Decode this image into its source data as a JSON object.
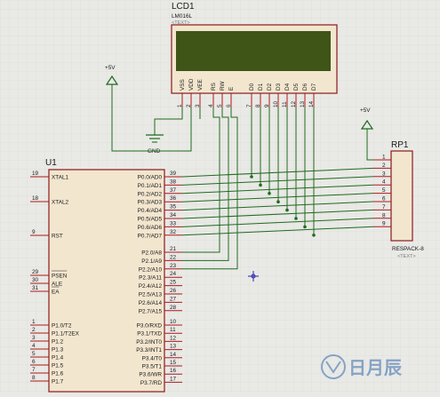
{
  "colors": {
    "background": "#e9e9e6",
    "grid": "#d7d7d2",
    "wire": "#1f6b1f",
    "body_fill": "#f2e6cf",
    "body_stroke": "#8b1a1a",
    "lcd_screen": "#3f5417",
    "pin_red": "#b01818",
    "probe": "#2b2bb0"
  },
  "lcd": {
    "designator": "LCD1",
    "part": "LM016L",
    "text_tag": "<TEXT>",
    "pin_names": [
      "VSS",
      "VDD",
      "VEE",
      "RS",
      "RW",
      "E",
      "D0",
      "D1",
      "D2",
      "D3",
      "D4",
      "D5",
      "D6",
      "D7"
    ],
    "pin_numbers": [
      "1",
      "2",
      "3",
      "4",
      "5",
      "6",
      "7",
      "8",
      "9",
      "10",
      "11",
      "12",
      "13",
      "14"
    ]
  },
  "power": {
    "vcc_left": "+5V",
    "vcc_right": "+5V",
    "gnd": "GND"
  },
  "mcu": {
    "designator": "U1",
    "left_pins": [
      {
        "num": "19",
        "name": "XTAL1"
      },
      {
        "num": "18",
        "name": "XTAL2"
      },
      {
        "num": "9",
        "name": "RST"
      },
      {
        "num": "29",
        "name": "PSEN"
      },
      {
        "num": "30",
        "name": "ALE"
      },
      {
        "num": "31",
        "name": "EA"
      },
      {
        "num": "1",
        "name": "P1.0/T2"
      },
      {
        "num": "2",
        "name": "P1.1/T2EX"
      },
      {
        "num": "3",
        "name": "P1.2"
      },
      {
        "num": "4",
        "name": "P1.3"
      },
      {
        "num": "5",
        "name": "P1.4"
      },
      {
        "num": "6",
        "name": "P1.5"
      },
      {
        "num": "7",
        "name": "P1.6"
      },
      {
        "num": "8",
        "name": "P1.7"
      }
    ],
    "right_pins": [
      {
        "num": "39",
        "name": "P0.0/AD0"
      },
      {
        "num": "38",
        "name": "P0.1/AD1"
      },
      {
        "num": "37",
        "name": "P0.2/AD2"
      },
      {
        "num": "36",
        "name": "P0.3/AD3"
      },
      {
        "num": "35",
        "name": "P0.4/AD4"
      },
      {
        "num": "34",
        "name": "P0.5/AD5"
      },
      {
        "num": "33",
        "name": "P0.6/AD6"
      },
      {
        "num": "32",
        "name": "P0.7/AD7"
      },
      {
        "num": "21",
        "name": "P2.0/A8"
      },
      {
        "num": "22",
        "name": "P2.1/A9"
      },
      {
        "num": "23",
        "name": "P2.2/A10"
      },
      {
        "num": "24",
        "name": "P2.3/A11"
      },
      {
        "num": "25",
        "name": "P2.4/A12"
      },
      {
        "num": "26",
        "name": "P2.5/A13"
      },
      {
        "num": "27",
        "name": "P2.6/A14"
      },
      {
        "num": "28",
        "name": "P2.7/A15"
      },
      {
        "num": "10",
        "name": "P3.0/RXD"
      },
      {
        "num": "11",
        "name": "P3.1/TXD"
      },
      {
        "num": "12",
        "name": "P3.2/INT0"
      },
      {
        "num": "13",
        "name": "P3.3/INT1"
      },
      {
        "num": "14",
        "name": "P3.4/T0"
      },
      {
        "num": "15",
        "name": "P3.5/T1"
      },
      {
        "num": "16",
        "name": "P3.6/WR"
      },
      {
        "num": "17",
        "name": "P3.7/RD"
      }
    ]
  },
  "rp": {
    "designator": "RP1",
    "part": "RESPACK-8",
    "text_tag": "<TEXT>",
    "pin_numbers": [
      "1",
      "2",
      "3",
      "4",
      "5",
      "6",
      "7",
      "8",
      "9"
    ]
  },
  "watermark": {
    "text": "日月辰",
    "icon": "logo-icon"
  }
}
